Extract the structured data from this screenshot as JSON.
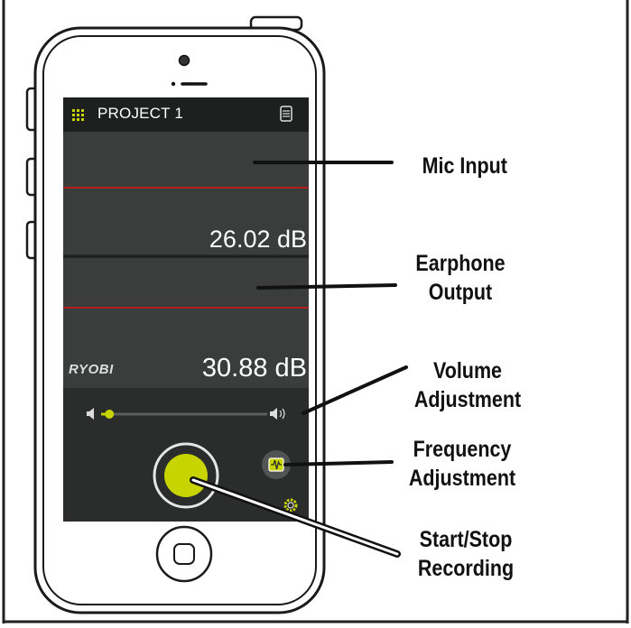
{
  "app": {
    "title": "PROJECT 1",
    "mic_level": "26.02 dB",
    "earphone_level": "30.88 dB",
    "brand": "RYOBI",
    "volume_level": 0.05
  },
  "callouts": {
    "mic_input": "Mic Input",
    "earphone_output_line1": "Earphone",
    "earphone_output_line2": "Output",
    "volume_line1": "Volume",
    "volume_line2": "Adjustment",
    "frequency_line1": "Frequency",
    "frequency_line2": "Adjustment",
    "record_line1": "Start/Stop",
    "record_line2": "Recording"
  },
  "colors": {
    "screen_bg": "#2a2d2c",
    "header_bg": "#1e201f",
    "panel_bg": "#3a3d3c",
    "accent": "#c8d400",
    "divider_red": "#b01e1e",
    "phone_outline": "#1a1a1a"
  }
}
